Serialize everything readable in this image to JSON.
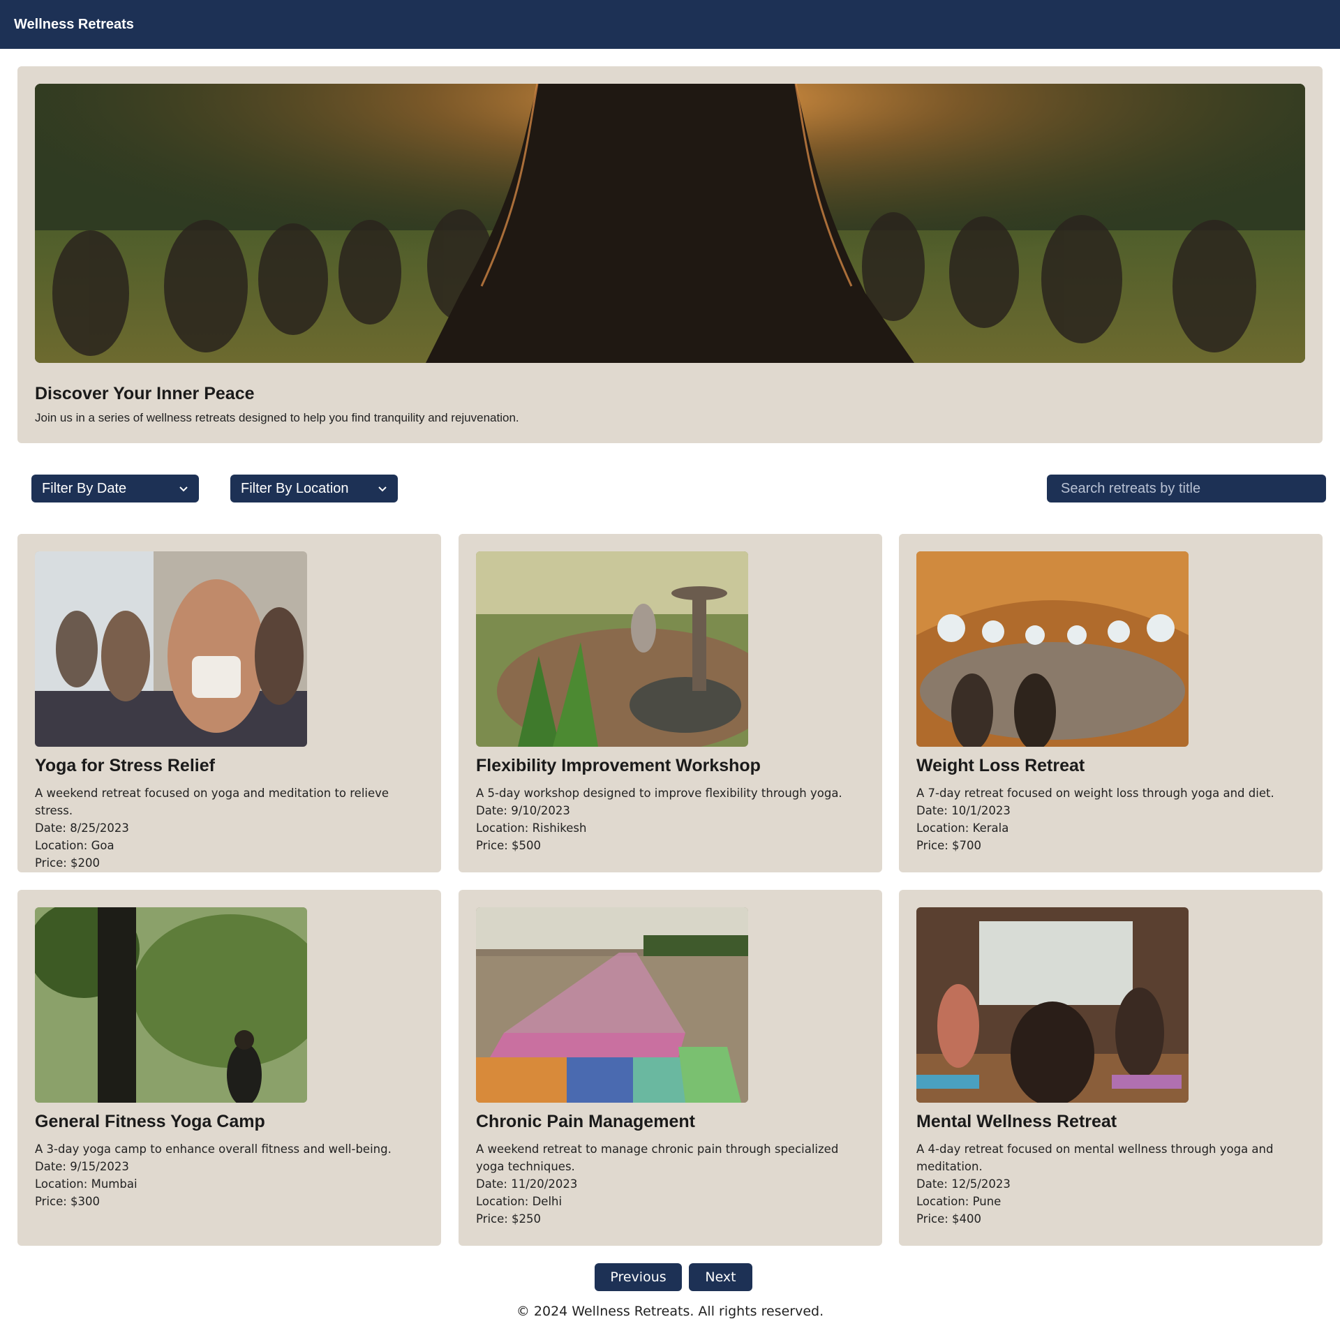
{
  "header": {
    "brand": "Wellness Retreats"
  },
  "hero": {
    "image": "yoga-group-sunset-park",
    "title": "Discover Your Inner Peace",
    "subtitle": "Join us in a series of wellness retreats designed to help you find tranquility and rejuvenation."
  },
  "filters": {
    "date_label": "Filter By Date",
    "location_label": "Filter By Location",
    "chevron_icon": "chevron-down-icon"
  },
  "search": {
    "placeholder": "Search retreats by title"
  },
  "retreats": [
    {
      "title": "Yoga for Stress Relief",
      "description": "A weekend retreat focused on yoga and meditation to relieve stress.",
      "date": "Date: 8/25/2023",
      "location": "Location: Goa",
      "price": "Price: $200",
      "image": "women-meditating-indoor-studio"
    },
    {
      "title": "Flexibility Improvement Workshop",
      "description": "A 5-day workshop designed to improve flexibility through yoga.",
      "date": "Date: 9/10/2023",
      "location": "Location: Rishikesh",
      "price": "Price: $500",
      "image": "garden-deck-fountain-yoga"
    },
    {
      "title": "Weight Loss Retreat",
      "description": "A 7-day retreat focused on weight loss through yoga and diet.",
      "date": "Date: 10/1/2023",
      "location": "Location: Kerala",
      "price": "Price: $700",
      "image": "wooden-dome-meditation-hall"
    },
    {
      "title": "General Fitness Yoga Camp",
      "description": "A 3-day yoga camp to enhance overall fitness and well-being.",
      "date": "Date: 9/15/2023",
      "location": "Location: Mumbai",
      "price": "Price: $300",
      "image": "forest-view-person-standing"
    },
    {
      "title": "Chronic Pain Management",
      "description": "A weekend retreat to manage chronic pain through specialized yoga techniques.",
      "date": "Date: 11/20/2023",
      "location": "Location: Delhi",
      "price": "Price: $250",
      "image": "yoga-mats-on-beach"
    },
    {
      "title": "Mental Wellness Retreat",
      "description": "A 4-day retreat focused on mental wellness through yoga and meditation.",
      "date": "Date: 12/5/2023",
      "location": "Location: Pune",
      "price": "Price: $400",
      "image": "studio-group-arms-raised"
    }
  ],
  "pagination": {
    "previous": "Previous",
    "next": "Next"
  },
  "footer": {
    "text": "© 2024 Wellness Retreats. All rights reserved."
  },
  "colors": {
    "navy": "#1d3155",
    "card_bg": "#e0d9cf",
    "page_bg": "#ffffff"
  }
}
